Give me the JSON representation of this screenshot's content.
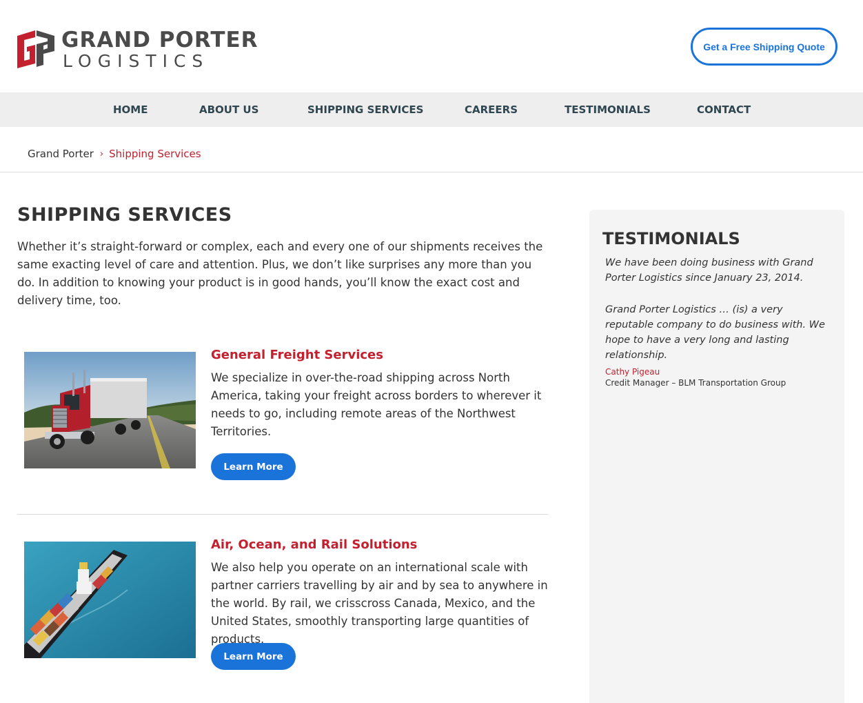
{
  "header": {
    "logo_top": "GRAND PORTER",
    "logo_bottom": "LOGISTICS",
    "quote_button": "Get a Free Shipping Quote"
  },
  "nav": {
    "items": [
      "HOME",
      "ABOUT US",
      "SHIPPING SERVICES",
      "CAREERS",
      "TESTIMONIALS",
      "CONTACT"
    ]
  },
  "breadcrumb": {
    "home": "Grand Porter",
    "separator": "›",
    "current": "Shipping Services"
  },
  "main": {
    "title": "SHIPPING SERVICES",
    "intro": "Whether it’s straight-forward or complex, each and every one of our shipments receives the same exacting level of care and attention.  Plus, we don’t like surprises any more than you do. In addition to knowing your product is in good hands, you’ll know the exact cost and delivery time, too.",
    "services": [
      {
        "title": "General Freight Services",
        "description": "We specialize in over-the-road shipping across North America, taking your freight across borders to wherever it needs to go, including remote areas of the Northwest Territories.",
        "button": "Learn More"
      },
      {
        "title": "Air, Ocean, and Rail Solutions",
        "description": "We also help you operate on an international scale with partner carriers travelling by air and by sea to anywhere in the world. By rail, we crisscross Canada, Mexico, and the United States, smoothly transporting large quantities of products.",
        "button": "Learn More"
      }
    ]
  },
  "sidebar": {
    "title": "TESTIMONIALS",
    "quote_1": "We have been doing business with Grand Porter Logistics since January 23, 2014.",
    "quote_2": "Grand Porter Logistics … (is) a very reputable company to do business with. We hope to have a very long and lasting relationship.",
    "author": "Cathy Pigeau",
    "role": "Credit Manager – BLM Transportation Group"
  },
  "colors": {
    "brand_red": "#c2202e",
    "accent_blue": "#1a73d9",
    "nav_bg": "#eeeeee",
    "nav_text": "#2f4650",
    "sidebar_bg": "#f4f4f4"
  },
  "icons": {
    "logo": "gp-logo-mark",
    "breadcrumb_separator": "chevron-right-icon"
  }
}
